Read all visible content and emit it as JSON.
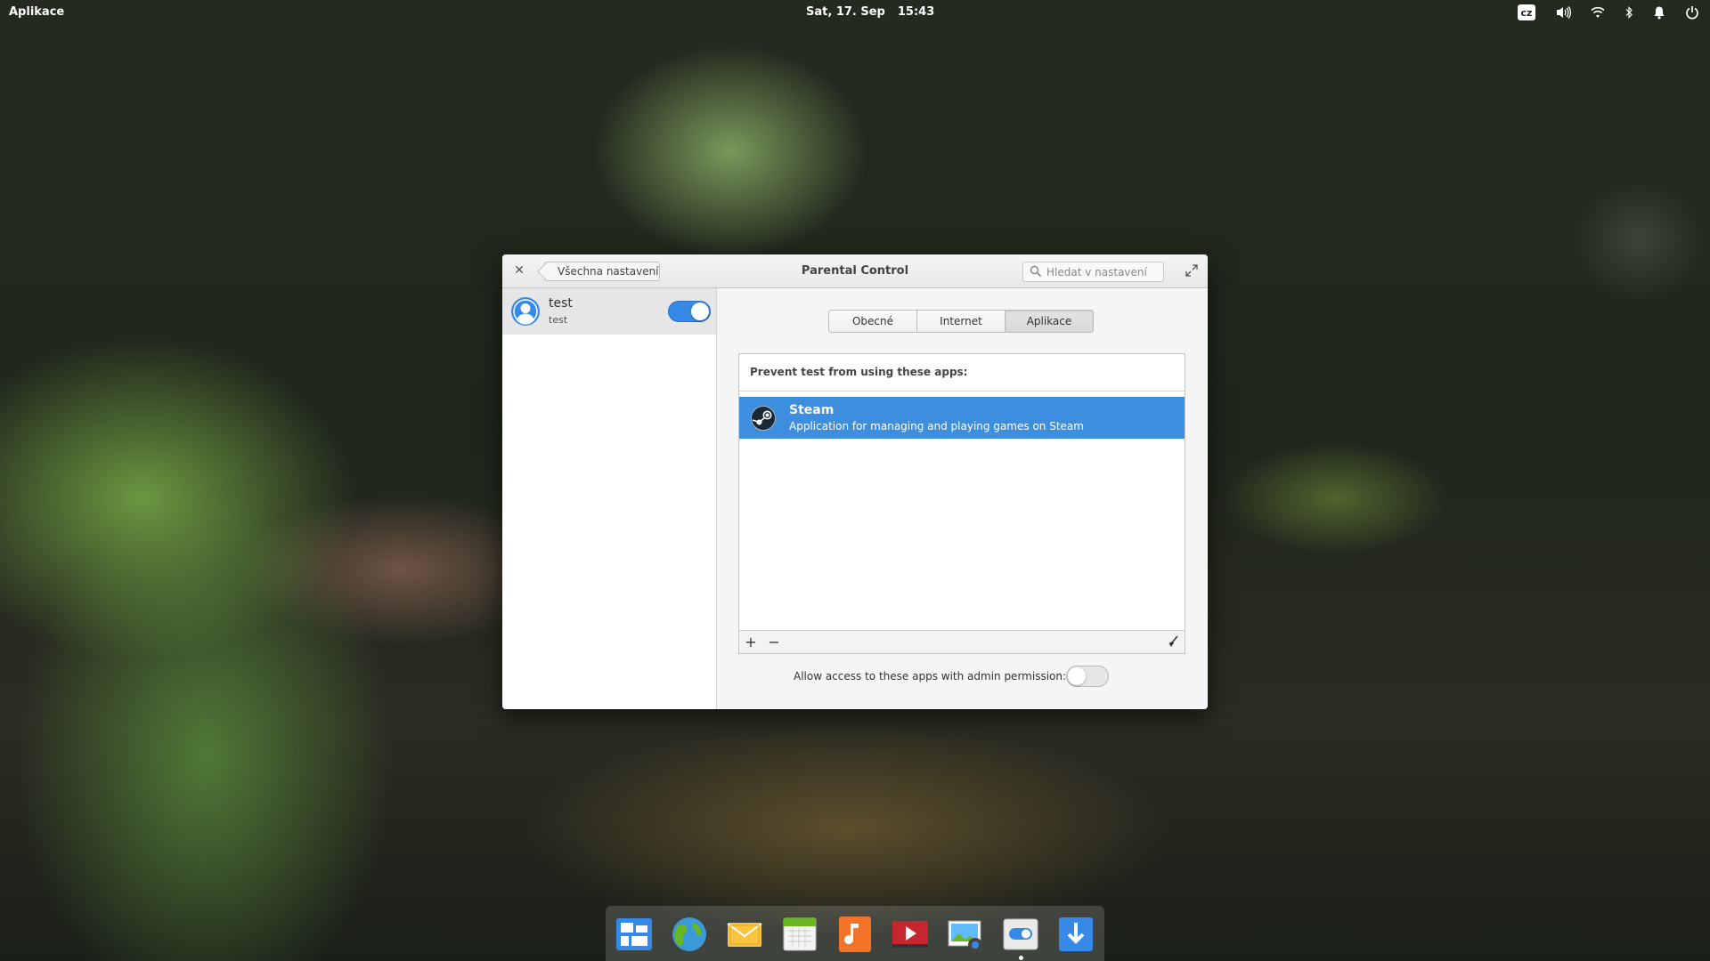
{
  "top_panel": {
    "apps_label": "Aplikace",
    "date": "Sat, 17. Sep",
    "time": "15:43",
    "keyboard_layout": "cz",
    "indicators": [
      "volume-icon",
      "wifi-icon",
      "bluetooth-icon",
      "notifications-icon",
      "power-icon"
    ]
  },
  "window": {
    "title": "Parental Control",
    "back_label": "Všechna nastavení",
    "search_placeholder": "Hledat v nastavení"
  },
  "sidebar": {
    "user": {
      "name": "test",
      "username": "test",
      "enabled": true
    }
  },
  "tabs": [
    {
      "label": "Obecné",
      "active": false
    },
    {
      "label": "Internet",
      "active": false
    },
    {
      "label": "Aplikace",
      "active": true
    }
  ],
  "apps_panel": {
    "header": "Prevent test from using these apps:",
    "apps": [
      {
        "name": "Steam",
        "description": "Application for managing and playing games on Steam",
        "selected": true
      }
    ],
    "add_symbol": "+",
    "remove_symbol": "−",
    "admin_permission_label": "Allow access to these apps with admin permission:",
    "admin_permission_enabled": false
  },
  "dock": {
    "items": [
      "multitasking-view",
      "web-browser",
      "mail",
      "calendar",
      "music",
      "videos",
      "photos",
      "system-settings",
      "appcenter"
    ]
  },
  "colors": {
    "accent": "#3689e6",
    "selection": "#3d8ede"
  }
}
